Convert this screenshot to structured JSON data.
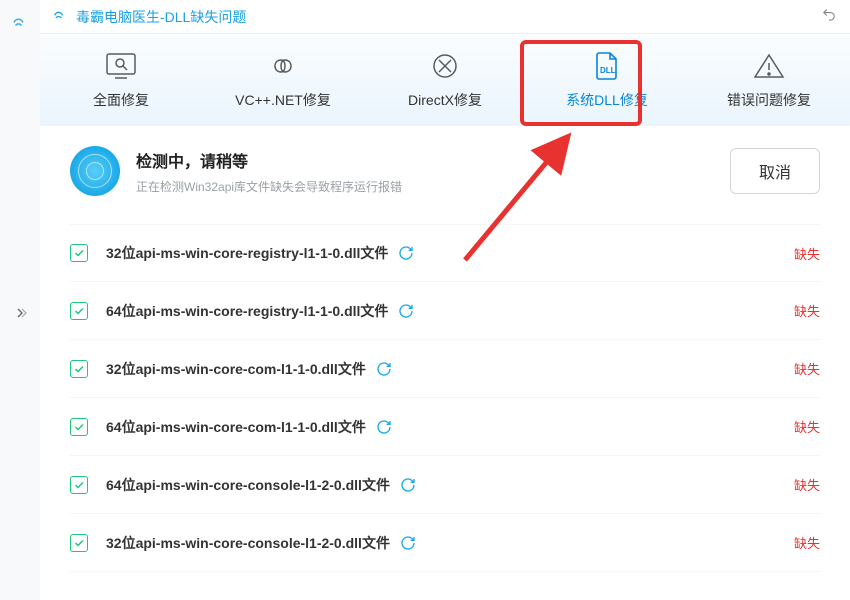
{
  "app": {
    "title": "毒霸电脑医生-DLL缺失问题"
  },
  "tabs": [
    {
      "id": "full-repair",
      "label": "全面修复"
    },
    {
      "id": "vcnet",
      "label": "VC++.NET修复"
    },
    {
      "id": "directx",
      "label": "DirectX修复"
    },
    {
      "id": "system-dll",
      "label": "系统DLL修复"
    },
    {
      "id": "error-qa",
      "label": "错误问题修复"
    }
  ],
  "status": {
    "title": "检测中，请稍等",
    "subtitle": "正在检测Win32api库文件缺失会导致程序运行报错",
    "cancel_label": "取消"
  },
  "rows": [
    {
      "name": "32位api-ms-win-core-registry-l1-1-0.dll文件",
      "status": "缺失"
    },
    {
      "name": "64位api-ms-win-core-registry-l1-1-0.dll文件",
      "status": "缺失"
    },
    {
      "name": "32位api-ms-win-core-com-l1-1-0.dll文件",
      "status": "缺失"
    },
    {
      "name": "64位api-ms-win-core-com-l1-1-0.dll文件",
      "status": "缺失"
    },
    {
      "name": "64位api-ms-win-core-console-l1-2-0.dll文件",
      "status": "缺失"
    },
    {
      "name": "32位api-ms-win-core-console-l1-2-0.dll文件",
      "status": "缺失"
    }
  ]
}
